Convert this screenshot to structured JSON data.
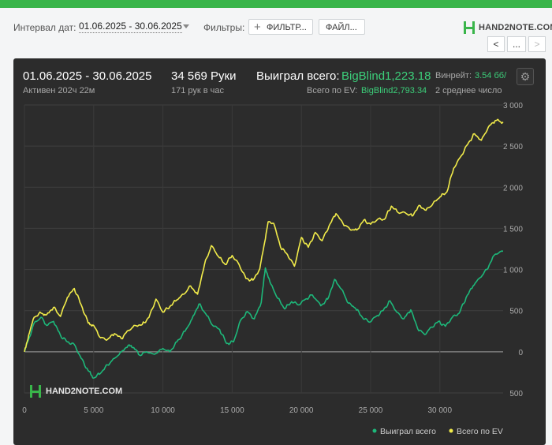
{
  "topbar": {
    "interval_label": "Интервал дат:",
    "interval_value": "01.06.2025 - 30.06.2025",
    "filters_label": "Фильтры:",
    "filter_button": "ФИЛЬТР...",
    "file_button": "ФАЙЛ...",
    "logo_text": "HAND2NOTE.COM",
    "nav_prev": "<",
    "nav_more": "...",
    "nav_next": ">"
  },
  "summary": {
    "period": "01.06.2025 - 30.06.2025",
    "active": "Активен 202ч 22м",
    "hands": "34 569 Руки",
    "hands_per_hour": "171 рук в час",
    "won_label": "Выиграл всего:",
    "won_value": "BigBlind1,223.18",
    "ev_label": "Всего по EV:",
    "ev_value": "BigBlind2,793.34",
    "winrate_label": "Винрейт:",
    "winrate_value": "3.54 бб/",
    "avg_text": "2 среднее число",
    "watermark": "HAND2NOTE.COM"
  },
  "colors": {
    "won": "#1db87a",
    "ev": "#f2ec4a",
    "panel_bg": "#2c2c2c",
    "brand": "#39b54a"
  },
  "chart_data": {
    "type": "line",
    "xlim": [
      0,
      34569
    ],
    "ylim": [
      -500,
      3000
    ],
    "x_ticks": [
      "0",
      "5 000",
      "10 000",
      "15 000",
      "20 000",
      "25 000",
      "30 000"
    ],
    "y_ticks": [
      "3 000",
      "2 500",
      "2 000",
      "1 500",
      "1 000",
      "500",
      "0",
      "500"
    ],
    "legend_position": "bottom-right",
    "series": [
      {
        "name": "Выиграл всего",
        "color": "#1db87a",
        "points": [
          [
            0,
            0
          ],
          [
            300,
            150
          ],
          [
            700,
            350
          ],
          [
            1200,
            420
          ],
          [
            1600,
            320
          ],
          [
            2100,
            370
          ],
          [
            2600,
            200
          ],
          [
            3100,
            120
          ],
          [
            3600,
            90
          ],
          [
            4100,
            -80
          ],
          [
            4600,
            -230
          ],
          [
            5000,
            -320
          ],
          [
            5500,
            -260
          ],
          [
            6000,
            -160
          ],
          [
            6500,
            -80
          ],
          [
            7000,
            0
          ],
          [
            7500,
            80
          ],
          [
            7900,
            50
          ],
          [
            8300,
            -40
          ],
          [
            8800,
            0
          ],
          [
            9400,
            -30
          ],
          [
            10000,
            40
          ],
          [
            10500,
            0
          ],
          [
            11000,
            120
          ],
          [
            11600,
            250
          ],
          [
            12100,
            400
          ],
          [
            12600,
            580
          ],
          [
            13100,
            460
          ],
          [
            13600,
            320
          ],
          [
            14100,
            270
          ],
          [
            14600,
            100
          ],
          [
            15100,
            120
          ],
          [
            15600,
            380
          ],
          [
            16100,
            490
          ],
          [
            16600,
            400
          ],
          [
            17100,
            600
          ],
          [
            17400,
            1020
          ],
          [
            17800,
            820
          ],
          [
            18300,
            650
          ],
          [
            18800,
            520
          ],
          [
            19300,
            610
          ],
          [
            19800,
            570
          ],
          [
            20300,
            640
          ],
          [
            20800,
            690
          ],
          [
            21400,
            560
          ],
          [
            21900,
            640
          ],
          [
            22400,
            880
          ],
          [
            22900,
            760
          ],
          [
            23400,
            590
          ],
          [
            23900,
            530
          ],
          [
            24400,
            420
          ],
          [
            24900,
            360
          ],
          [
            25400,
            430
          ],
          [
            25900,
            500
          ],
          [
            26400,
            620
          ],
          [
            26900,
            480
          ],
          [
            27400,
            400
          ],
          [
            27900,
            510
          ],
          [
            28400,
            280
          ],
          [
            28900,
            210
          ],
          [
            29400,
            300
          ],
          [
            29900,
            370
          ],
          [
            30400,
            310
          ],
          [
            30900,
            420
          ],
          [
            31400,
            470
          ],
          [
            31900,
            660
          ],
          [
            32400,
            800
          ],
          [
            32900,
            900
          ],
          [
            33400,
            1000
          ],
          [
            33900,
            1170
          ],
          [
            34569,
            1223
          ]
        ]
      },
      {
        "name": "Всего по EV",
        "color": "#f2ec4a",
        "points": [
          [
            0,
            0
          ],
          [
            300,
            200
          ],
          [
            700,
            420
          ],
          [
            1200,
            470
          ],
          [
            1600,
            450
          ],
          [
            2100,
            540
          ],
          [
            2600,
            430
          ],
          [
            3100,
            660
          ],
          [
            3600,
            770
          ],
          [
            4100,
            570
          ],
          [
            4600,
            350
          ],
          [
            5000,
            320
          ],
          [
            5500,
            170
          ],
          [
            6000,
            150
          ],
          [
            6500,
            220
          ],
          [
            7000,
            160
          ],
          [
            7500,
            260
          ],
          [
            8000,
            320
          ],
          [
            8500,
            330
          ],
          [
            9000,
            420
          ],
          [
            9500,
            640
          ],
          [
            10000,
            480
          ],
          [
            10500,
            550
          ],
          [
            11000,
            630
          ],
          [
            11500,
            700
          ],
          [
            12000,
            800
          ],
          [
            12500,
            700
          ],
          [
            13000,
            1060
          ],
          [
            13500,
            1290
          ],
          [
            14000,
            1160
          ],
          [
            14500,
            1060
          ],
          [
            15000,
            1170
          ],
          [
            15500,
            1060
          ],
          [
            16000,
            890
          ],
          [
            16500,
            870
          ],
          [
            17000,
            1010
          ],
          [
            17300,
            1290
          ],
          [
            17600,
            1580
          ],
          [
            18000,
            1560
          ],
          [
            18500,
            1270
          ],
          [
            19000,
            1180
          ],
          [
            19500,
            1040
          ],
          [
            20000,
            1390
          ],
          [
            20500,
            1270
          ],
          [
            21000,
            1450
          ],
          [
            21500,
            1350
          ],
          [
            22000,
            1530
          ],
          [
            22500,
            1680
          ],
          [
            23000,
            1560
          ],
          [
            23500,
            1490
          ],
          [
            24000,
            1480
          ],
          [
            24500,
            1600
          ],
          [
            25000,
            1550
          ],
          [
            25500,
            1610
          ],
          [
            26000,
            1610
          ],
          [
            26500,
            1770
          ],
          [
            27000,
            1690
          ],
          [
            27500,
            1690
          ],
          [
            28000,
            1650
          ],
          [
            28500,
            1780
          ],
          [
            29000,
            1720
          ],
          [
            29500,
            1800
          ],
          [
            30000,
            1880
          ],
          [
            30500,
            1940
          ],
          [
            31000,
            2230
          ],
          [
            31500,
            2370
          ],
          [
            32000,
            2520
          ],
          [
            32500,
            2650
          ],
          [
            33000,
            2570
          ],
          [
            33500,
            2730
          ],
          [
            34000,
            2810
          ],
          [
            34569,
            2793
          ]
        ]
      }
    ]
  }
}
